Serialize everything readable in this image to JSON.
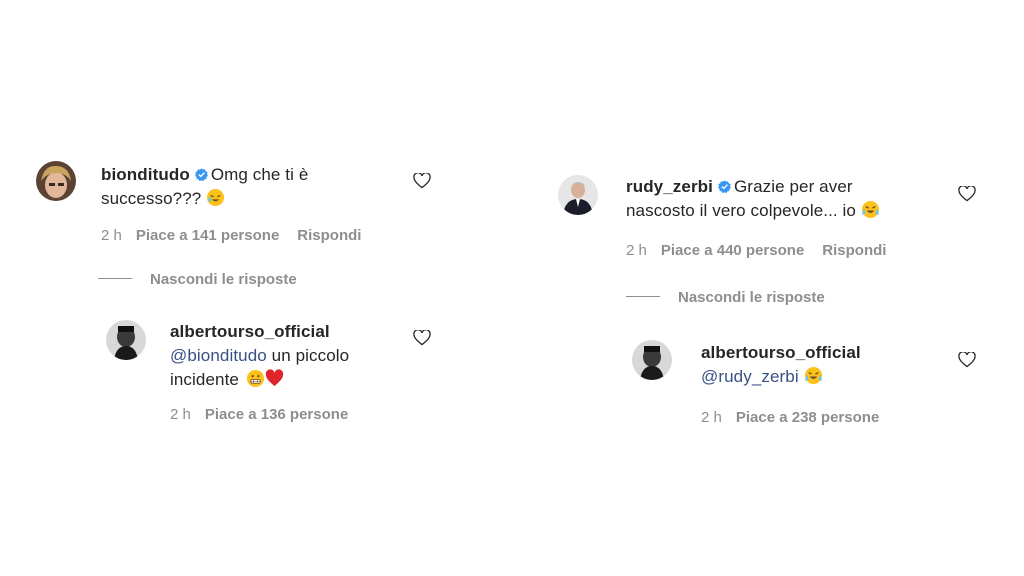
{
  "left": {
    "comment": {
      "username": "bionditudo",
      "text_line1": "Omg che ti è",
      "text_line2": "successo???",
      "emoji": "crying-laughing-tilted",
      "time": "2 h",
      "likes": "Piace a 141 persone",
      "reply": "Rispondi"
    },
    "hide_replies": "Nascondi le risposte",
    "reply": {
      "username": "albertourso_official",
      "mention": "@bionditudo",
      "text_line1": " un piccolo",
      "text_line2": "incidente",
      "emoji": [
        "grimacing",
        "red-heart"
      ],
      "time": "2 h",
      "likes": "Piace a 136 persone"
    }
  },
  "right": {
    "comment": {
      "username": "rudy_zerbi",
      "text_line1": "Grazie per aver",
      "text_line2": "nascosto il vero colpevole... io",
      "emoji": "loudly-crying-laughing",
      "time": "2 h",
      "likes": "Piace a 440 persone",
      "reply": "Rispondi"
    },
    "hide_replies": "Nascondi le risposte",
    "reply": {
      "username": "albertourso_official",
      "mention": "@rudy_zerbi",
      "emoji": "loudly-crying-laughing",
      "time": "2 h",
      "likes": "Piace a 238 persone"
    }
  },
  "colors": {
    "text": "#262626",
    "secondary": "#8e8e8e",
    "mention": "#385185",
    "verified": "#3897f0"
  }
}
